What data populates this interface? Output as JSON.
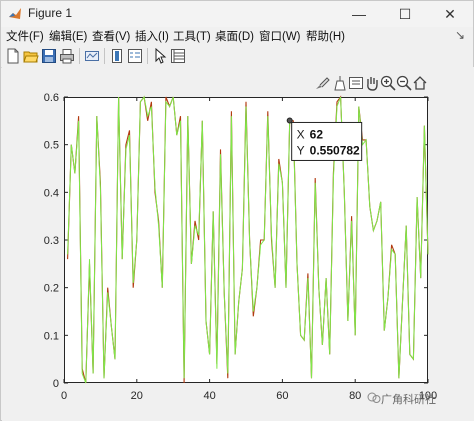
{
  "window": {
    "title": "Figure 1",
    "minimize_glyph": "—",
    "maximize_glyph": "☐",
    "close_glyph": "✕"
  },
  "menu": {
    "items": [
      "文件(F)",
      "编辑(E)",
      "查看(V)",
      "插入(I)",
      "工具(T)",
      "桌面(D)",
      "窗口(W)",
      "帮助(H)"
    ],
    "pin_glyph": "↘"
  },
  "toolbar": {
    "icons": [
      "new-figure-icon",
      "open-file-icon",
      "save-icon",
      "print-icon",
      "link-plot-icon",
      "insert-colorbar-icon",
      "insert-legend-icon",
      "edit-plot-arrow-icon",
      "property-inspector-icon"
    ]
  },
  "axes_toolbar": {
    "icons": [
      "brush-icon",
      "data-tips-icon",
      "export-icon",
      "pan-hand-icon",
      "zoom-in-icon",
      "zoom-out-icon",
      "home-icon"
    ]
  },
  "datatip": {
    "x_label": "X",
    "x_value": "62",
    "y_label": "Y",
    "y_value": "0.550782"
  },
  "watermark": {
    "text": "广角科研社"
  },
  "colors": {
    "series1": "#b23a10",
    "series2": "#7fe84a",
    "axis": "#262626"
  },
  "chart_data": {
    "type": "line",
    "title": "",
    "xlabel": "",
    "ylabel": "",
    "xlim": [
      0,
      100
    ],
    "ylim": [
      0,
      0.6
    ],
    "xticks": [
      0,
      20,
      40,
      60,
      80,
      100
    ],
    "yticks": [
      0,
      0.1,
      0.2,
      0.3,
      0.4,
      0.5,
      0.6
    ],
    "ytick_labels": [
      "0",
      "0.1",
      "0.2",
      "0.3",
      "0.4",
      "0.5",
      "0.6"
    ],
    "grid": false,
    "x": [
      1,
      2,
      3,
      4,
      5,
      6,
      7,
      8,
      9,
      10,
      11,
      12,
      13,
      14,
      15,
      16,
      17,
      18,
      19,
      20,
      21,
      22,
      23,
      24,
      25,
      26,
      27,
      28,
      29,
      30,
      31,
      32,
      33,
      34,
      35,
      36,
      37,
      38,
      39,
      40,
      41,
      42,
      43,
      44,
      45,
      46,
      47,
      48,
      49,
      50,
      51,
      52,
      53,
      54,
      55,
      56,
      57,
      58,
      59,
      60,
      61,
      62,
      63,
      64,
      65,
      66,
      67,
      68,
      69,
      70,
      71,
      72,
      73,
      74,
      75,
      76,
      77,
      78,
      79,
      80,
      81,
      82,
      83,
      84,
      85,
      86,
      87,
      88,
      89,
      90,
      91,
      92,
      93,
      94,
      95,
      96,
      97,
      98,
      99,
      100
    ],
    "series": [
      {
        "values": [
          0.26,
          0.5,
          0.44,
          0.56,
          0.03,
          0.0,
          0.25,
          0.02,
          0.56,
          0.42,
          0.01,
          0.2,
          0.12,
          0.05,
          0.6,
          0.26,
          0.5,
          0.53,
          0.2,
          0.3,
          0.59,
          0.6,
          0.55,
          0.59,
          0.4,
          0.34,
          0.2,
          0.6,
          0.58,
          0.6,
          0.52,
          0.56,
          0.0,
          0.56,
          0.25,
          0.34,
          0.3,
          0.55,
          0.13,
          0.06,
          0.36,
          0.04,
          0.49,
          0.19,
          0.01,
          0.57,
          0.06,
          0.17,
          0.24,
          0.59,
          0.3,
          0.14,
          0.2,
          0.3,
          0.3,
          0.57,
          0.3,
          0.2,
          0.47,
          0.42,
          0.2,
          0.55,
          0.55,
          0.25,
          0.1,
          0.09,
          0.23,
          0.01,
          0.43,
          0.2,
          0.08,
          0.22,
          0.06,
          0.44,
          0.59,
          0.6,
          0.4,
          0.13,
          0.35,
          0.1,
          0.58,
          0.51,
          0.51,
          0.37,
          0.32,
          0.34,
          0.38,
          0.11,
          0.18,
          0.29,
          0.27,
          0.01,
          0.17,
          0.33,
          0.06,
          0.05,
          0.39,
          0.22,
          0.54,
          0.27
        ]
      },
      {
        "values": [
          0.27,
          0.5,
          0.44,
          0.55,
          0.02,
          0.0,
          0.26,
          0.02,
          0.56,
          0.41,
          0.01,
          0.19,
          0.12,
          0.05,
          0.6,
          0.26,
          0.49,
          0.52,
          0.21,
          0.3,
          0.59,
          0.6,
          0.56,
          0.58,
          0.41,
          0.33,
          0.2,
          0.59,
          0.58,
          0.6,
          0.52,
          0.55,
          0.01,
          0.56,
          0.25,
          0.33,
          0.31,
          0.55,
          0.13,
          0.06,
          0.36,
          0.03,
          0.48,
          0.19,
          0.02,
          0.56,
          0.06,
          0.17,
          0.24,
          0.58,
          0.3,
          0.15,
          0.2,
          0.29,
          0.3,
          0.56,
          0.31,
          0.2,
          0.46,
          0.42,
          0.2,
          0.55,
          0.54,
          0.25,
          0.1,
          0.09,
          0.22,
          0.01,
          0.42,
          0.2,
          0.08,
          0.22,
          0.06,
          0.43,
          0.58,
          0.6,
          0.4,
          0.13,
          0.34,
          0.1,
          0.58,
          0.5,
          0.51,
          0.37,
          0.32,
          0.34,
          0.38,
          0.11,
          0.18,
          0.28,
          0.27,
          0.01,
          0.17,
          0.33,
          0.06,
          0.05,
          0.39,
          0.22,
          0.54,
          0.27
        ]
      }
    ]
  }
}
